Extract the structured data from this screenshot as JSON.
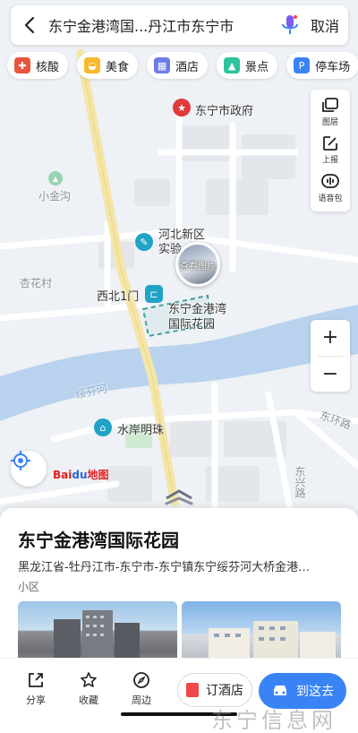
{
  "search": {
    "text": "东宁金港湾国...丹江市东宁市",
    "cancel_label": "取消"
  },
  "categories": [
    {
      "label": "核酸",
      "icon": "swab-icon",
      "color": "#e8553f"
    },
    {
      "label": "美食",
      "icon": "food-icon",
      "color": "#f6b92b"
    },
    {
      "label": "酒店",
      "icon": "hotel-icon",
      "color": "#6c7ce8"
    },
    {
      "label": "景点",
      "icon": "scenery-icon",
      "color": "#2cc49a"
    },
    {
      "label": "停车场",
      "icon": "parking-icon",
      "color": "#3a83f5"
    }
  ],
  "tools": {
    "layers": "图层",
    "report": "上报",
    "voice": "语音包"
  },
  "map": {
    "labels": {
      "gov": "东宁市政府",
      "mountain": "小金沟",
      "village": "杏花村",
      "school_line1": "河北新区",
      "school_line2": "实验",
      "gate": "西北1门",
      "target_line1": "东宁金港湾",
      "target_line2": "国际花园",
      "river": "绥芬河",
      "hotel": "水岸明珠",
      "road1": "东环路",
      "road2": "东兴路",
      "photo_view": "查看图片"
    },
    "logo_text": "Bai",
    "logo_du": "du",
    "logo_suffix": "地图"
  },
  "place": {
    "name": "东宁金港湾国际花园",
    "address": "黑龙江省-牡丹江市-东宁市-东宁镇东宁绥芬河大桥金港…",
    "type": "小区"
  },
  "actions": {
    "share": "分享",
    "favorite": "收藏",
    "nearby": "周边",
    "book_hotel": "订酒店",
    "go_here": "到这去"
  },
  "watermark": "东宁信息网",
  "colors": {
    "accent": "#3a83f5",
    "river": "#b9d3ee",
    "road_main": "#f4e6a8",
    "gov_pin": "#e0383b"
  }
}
